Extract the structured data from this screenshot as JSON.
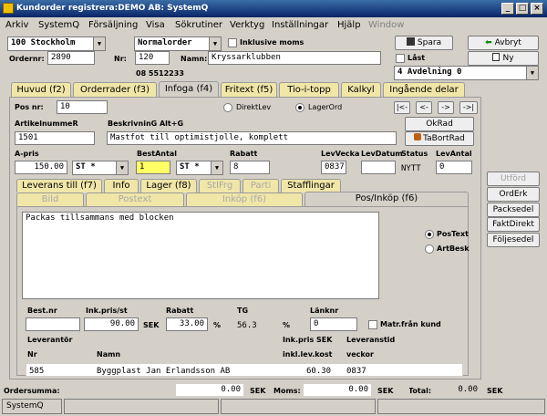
{
  "window": {
    "title": "Kundorder registrera:DEMO AB: SystemQ",
    "btn_min": "_",
    "btn_max": "□",
    "btn_close": "×"
  },
  "menu": [
    "Arkiv",
    "SystemQ",
    "Försäljning",
    "Visa",
    "Sökrutiner",
    "Verktyg",
    "Inställningar",
    "Hjälp",
    "Window"
  ],
  "header": {
    "store": "100  Stockholm",
    "ordertype": "Normalorder",
    "incl_vat_label": "Inklusive moms",
    "ordernr_label": "Ordernr:",
    "ordernr": "2890",
    "nr_label": "Nr:",
    "nr": "120",
    "namn_label": "Namn:",
    "namn": "Kryssarklubben",
    "phone": "08 5512233",
    "save_btn": "Spara",
    "cancel_btn": "Avbryt",
    "locked_label": "Låst",
    "new_btn": "Ny",
    "department": "4  Avdelning 0"
  },
  "main_tabs": [
    "Huvud (f2)",
    "Orderrader (f3)",
    "Infoga (f4)",
    "Fritext (f5)",
    "Tio-i-topp",
    "Kalkyl",
    "Ingående delar"
  ],
  "infoga": {
    "posnr_label": "Pos nr:",
    "posnr": "10",
    "direktlev_label": "DirektLev",
    "lagerord_label": "LagerOrd",
    "nav": [
      "|<-",
      "<-",
      "->",
      "->|"
    ],
    "artnr_label": "ArtikelnummeR",
    "artnr": "1501",
    "desc_label": "BeskrivninG Alt+G",
    "desc": "Mastfot till optimistjolle, komplett",
    "okrad_btn": "OkRad",
    "tabort_btn": "TaBortRad",
    "apris_label": "A-pris",
    "apris": "150.00",
    "unit1": "ST *",
    "bestantal_label": "BestAntal",
    "bestantal": "1",
    "unit2": "ST *",
    "rabatt_label": "Rabatt",
    "rabatt": "8",
    "levvecka_label": "LevVecka",
    "levvecka": "0837",
    "levdatum_label": "LevDatum",
    "levdatum": "",
    "status_label": "Status",
    "status": "NYTT",
    "levantal_label": "LevAntal",
    "levantal": "0"
  },
  "sub_tabs_row1": [
    "Leverans till (f7)",
    "Info",
    "Lager (f8)",
    "StlFrg",
    "Parti",
    "Stafflingar"
  ],
  "sub_tabs_row2": [
    "Bild",
    "Postext",
    "Inköp (f6)",
    "Pos/Inköp (f6)"
  ],
  "pos": {
    "text": "Packas tillsammans med blocken",
    "postext_label": "PosText",
    "artbesk_label": "ArtBesk",
    "bestnr_label": "Best.nr",
    "bestnr": "",
    "inkpris_label": "Ink.pris/st",
    "inkpris": "90.00",
    "sek1": "SEK",
    "rabatt_label": "Rabatt",
    "rabatt": "33.00",
    "pct1": "%",
    "tg_label": "TG",
    "tg": "56.3",
    "pct2": "%",
    "lanknr_label": "Länknr",
    "lanknr": "0",
    "matr_label": "Matr.från kund",
    "leverantor_label": "Leverantör",
    "inkpris_sek_label": "Ink.pris SEK",
    "leveranstid_label": "Leveranstid",
    "nr_label": "Nr",
    "namn_label": "Namn",
    "inkl_lev_label": "inkl.lev.kost",
    "veckor_label": "veckor",
    "lev_nr": "585",
    "lev_namn": "Byggplast Jan Erlandsson AB",
    "lev_kost": "60.30",
    "lev_vecka": "0837"
  },
  "right_buttons": [
    "Utförd",
    "OrdErk",
    "Packsedel",
    "FaktDirekt",
    "Följesedel"
  ],
  "footer": {
    "ordersumma_label": "Ordersumma:",
    "ordersumma": "0.00",
    "sek1": "SEK",
    "moms_label": "Moms:",
    "moms": "0.00",
    "sek2": "SEK",
    "total_label": "Total:",
    "total": "0.00",
    "sek3": "SEK"
  },
  "statusbar": {
    "app": "SystemQ"
  },
  "colors": {
    "title": "#0a246a",
    "tab": "#f0e6a8",
    "highlight": "#ffff66"
  }
}
